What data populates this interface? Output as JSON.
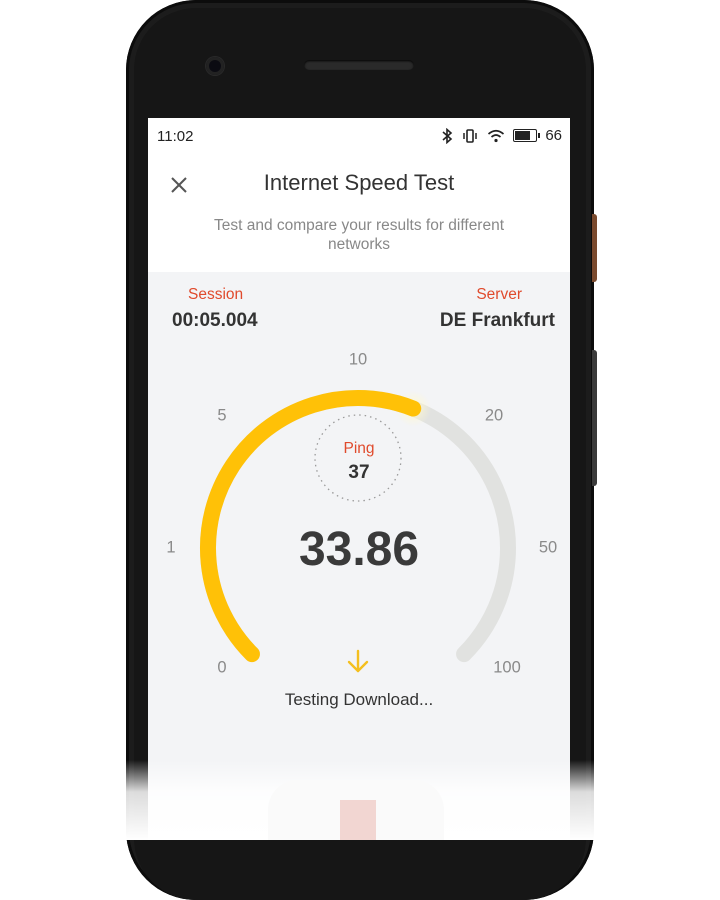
{
  "status_bar": {
    "time": "11:02",
    "battery_level": "66",
    "icons": [
      "bluetooth-icon",
      "vibrate-icon",
      "wifi-icon",
      "battery-icon"
    ]
  },
  "header": {
    "close_icon": "close-icon",
    "title": "Internet Speed Test",
    "subtitle": "Test and compare your results for different networks"
  },
  "session": {
    "label": "Session",
    "value": "00:05.004"
  },
  "server": {
    "label": "Server",
    "value": "DE Frankfurt"
  },
  "gauge": {
    "ticks": [
      "0",
      "1",
      "5",
      "10",
      "20",
      "50",
      "100"
    ],
    "progress_fraction": 0.58,
    "colors": {
      "active": "#ffc107",
      "track": "#e1e2e0"
    }
  },
  "ping": {
    "label": "Ping",
    "value": "37"
  },
  "speed": {
    "value": "33.86"
  },
  "test_status": {
    "text": "Testing Download...",
    "icon": "arrow-down-icon"
  },
  "colors": {
    "accent": "#ffc107",
    "label_red": "#e04a2c",
    "text_dark": "#333333"
  }
}
